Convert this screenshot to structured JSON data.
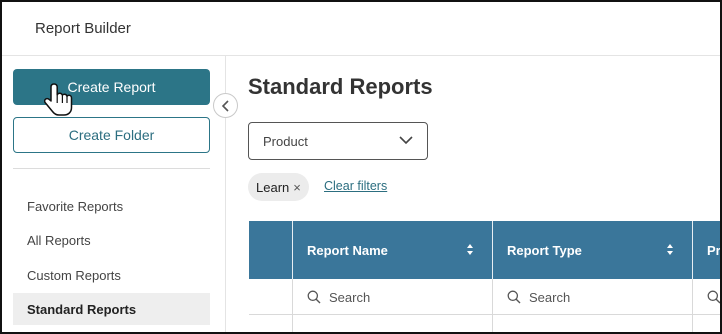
{
  "header": {
    "title": "Report Builder"
  },
  "sidebar": {
    "create_report_label": "Create Report",
    "create_folder_label": "Create Folder",
    "nav_items": [
      {
        "label": "Favorite Reports"
      },
      {
        "label": "All Reports"
      },
      {
        "label": "Custom Reports"
      },
      {
        "label": "Standard Reports",
        "active": true
      }
    ]
  },
  "main": {
    "title": "Standard Reports",
    "product_select": {
      "value": "Product"
    },
    "filter_chip": {
      "label": "Learn",
      "remove_glyph": "×"
    },
    "clear_filters_label": "Clear filters",
    "table": {
      "columns": [
        {
          "label": ""
        },
        {
          "label": "Report Name"
        },
        {
          "label": "Report Type"
        },
        {
          "label": "Pr"
        }
      ],
      "search_placeholder": "Search"
    }
  },
  "colors": {
    "primary_button": "#2c7587",
    "table_header": "#3a769a",
    "link": "#2c6e80",
    "active_nav_bg": "#eeeeee"
  },
  "icons": {
    "collapse": "chevron-left-icon",
    "dropdown": "chevron-down-icon",
    "sort": "sort-icon",
    "search": "search-icon",
    "cursor": "hand-pointer-icon"
  }
}
